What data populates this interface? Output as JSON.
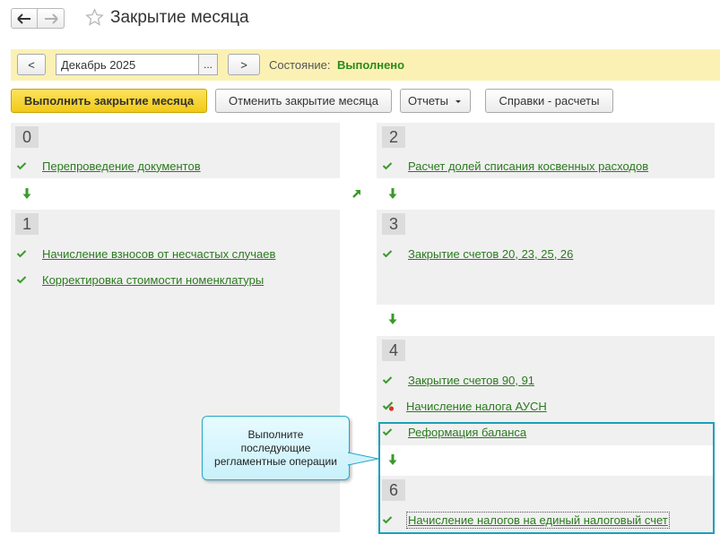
{
  "window": {
    "title": "Закрытие месяца"
  },
  "period": {
    "prev_label": "<",
    "value": "Декабрь 2025",
    "choose_label": "...",
    "next_label": ">",
    "state_label": "Состояние:",
    "state_value": "Выполнено"
  },
  "toolbar": {
    "run_label": "Выполнить закрытие месяца",
    "cancel_label": "Отменить закрытие месяца",
    "reports_label": "Отчеты",
    "help_label": "Справки - расчеты"
  },
  "steps": {
    "s0": {
      "number": "0",
      "items": [
        "Перепроведение документов"
      ]
    },
    "s1": {
      "number": "1",
      "items": [
        "Начисление взносов от несчастых случаев",
        "Корректировка стоимости номенклатуры"
      ]
    },
    "s2": {
      "number": "2",
      "items": [
        "Расчет долей списания косвенных расходов"
      ]
    },
    "s3": {
      "number": "3",
      "items": [
        "Закрытие счетов 20, 23, 25, 26"
      ]
    },
    "s4": {
      "number": "4",
      "items": [
        "Закрытие счетов 90, 91",
        "Начисление налога АУСН",
        "Реформация баланса"
      ]
    },
    "s6": {
      "number": "6",
      "items": [
        "Начисление налогов на единый налоговый счет"
      ]
    }
  },
  "tooltip": {
    "line1": "Выполните",
    "line2": "последующие",
    "line3": "регламентные операции"
  },
  "colors": {
    "accent_green": "#2b7a1f",
    "done_green": "#2c8a1a",
    "panel_gray": "#f0f0f0",
    "period_bar": "#fbf1b4",
    "primary_button": "#f2c918",
    "highlight": "#1aa2b8"
  },
  "icons": {
    "back": "arrow-left-icon",
    "forward": "arrow-right-icon",
    "favorite": "star-icon",
    "done": "check-icon",
    "done_warning": "check-warning-icon",
    "flow_down": "arrow-down-icon",
    "flow_diag": "arrow-up-right-icon"
  }
}
